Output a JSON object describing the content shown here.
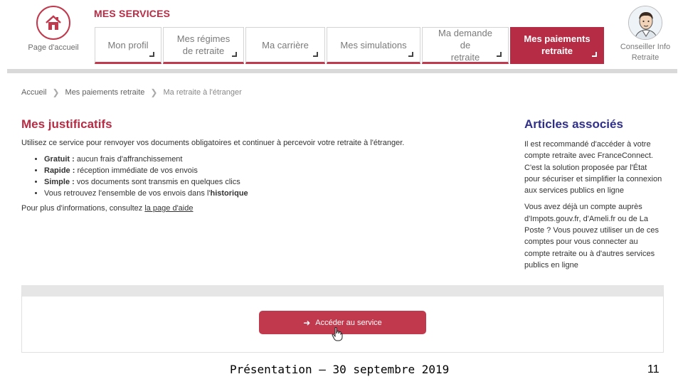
{
  "header": {
    "home_label": "Page d'accueil",
    "services_title": "MES SERVICES",
    "advisor_label_line1": "Conseiller Info",
    "advisor_label_line2": "Retraite",
    "home_icon": "house-icon",
    "avatar_icon": "advisor-avatar"
  },
  "tabs": [
    {
      "line1": "Mon profil",
      "line2": "",
      "active": false
    },
    {
      "line1": "Mes régimes",
      "line2": "de retraite",
      "active": false
    },
    {
      "line1": "Ma carrière",
      "line2": "",
      "active": false
    },
    {
      "line1": "Mes simulations",
      "line2": "",
      "active": false
    },
    {
      "line1": "Ma demande de",
      "line2": "retraite",
      "active": false
    },
    {
      "line1": "Mes paiements",
      "line2": "retraite",
      "active": true
    }
  ],
  "breadcrumb": {
    "home": "Accueil",
    "level2": "Mes paiements retraite",
    "current": "Ma retraite à l'étranger"
  },
  "main": {
    "title": "Mes justificatifs",
    "intro": "Utilisez ce service pour renvoyer vos documents obligatoires et continuer à percevoir votre retraite à l'étranger.",
    "bullets": [
      {
        "bold": "Gratuit :",
        "text": " aucun frais d'affranchissement",
        "bold_end": ""
      },
      {
        "bold": "Rapide :",
        "text": " réception immédiate de vos envois",
        "bold_end": ""
      },
      {
        "bold": "Simple :",
        "text": " vos documents sont transmis en quelques clics",
        "bold_end": ""
      },
      {
        "bold": "",
        "text": "Vous retrouvez l'ensemble de vos envois dans l'",
        "bold_end": "historique"
      }
    ],
    "more_info_prefix": "Pour plus d'informations, consultez ",
    "more_info_link": "la page d'aide"
  },
  "aside": {
    "title": "Articles associés",
    "paragraph1": "Il est recommandé d'accéder à votre compte retraite avec FranceConnect. C'est la solution proposée par l'État pour sécuriser et simplifier la connexion aux services publics en ligne",
    "paragraph2": "Vous avez déjà un compte auprès d'Impots.gouv.fr, d'Ameli.fr ou de La Poste ? Vous pouvez utiliser un de ces comptes pour vous connecter au compte retraite ou à d'autres services publics en ligne"
  },
  "service": {
    "cta_label": "Accéder au service",
    "cta_icon": "arrow-right-icon"
  },
  "footer": {
    "text": "Présentation – 30 septembre 2019",
    "page_number": "11"
  },
  "colors": {
    "brand_red": "#b72c45",
    "aside_title_blue": "#2f2f8a"
  }
}
